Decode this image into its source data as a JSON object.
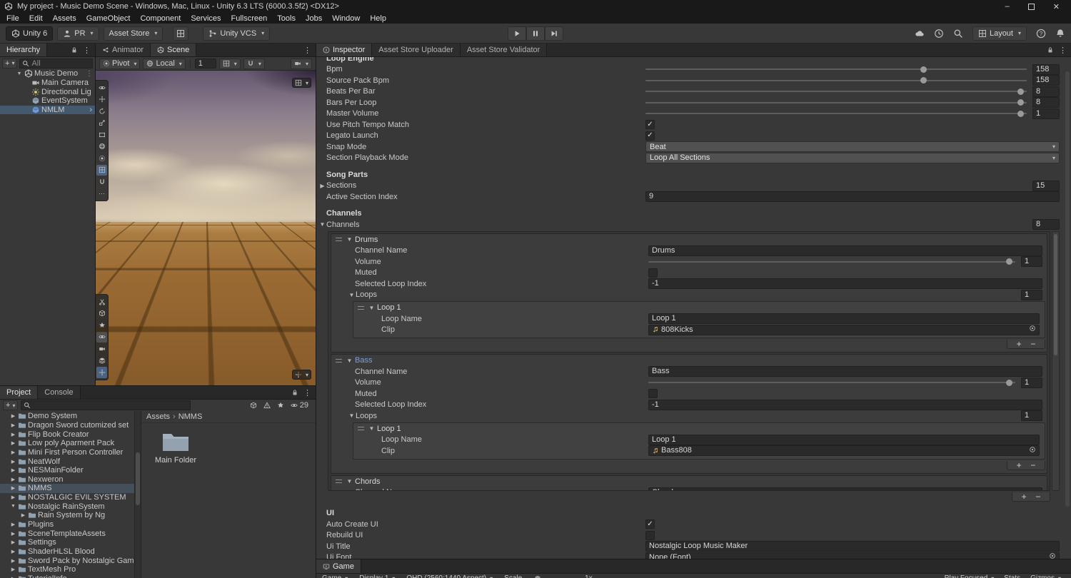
{
  "window": {
    "title": "My project - Music Demo Scene - Windows, Mac, Linux - Unity 6.3 LTS (6000.3.5f2) <DX12>",
    "menus": [
      "File",
      "Edit",
      "Assets",
      "GameObject",
      "Component",
      "Services",
      "Fullscreen",
      "Tools",
      "Jobs",
      "Window",
      "Help"
    ]
  },
  "toolbar": {
    "unity_badge": "Unity 6",
    "account": "PR",
    "asset_store": "Asset Store",
    "vcs": "Unity VCS",
    "layout": "Layout"
  },
  "hierarchy": {
    "tab": "Hierarchy",
    "search_filter": "All",
    "scene_name": "Music Demo",
    "items": [
      {
        "label": "Main Camera",
        "icon": "camera"
      },
      {
        "label": "Directional Lig",
        "icon": "light"
      },
      {
        "label": "EventSystem",
        "icon": "cube"
      },
      {
        "label": "NMLM",
        "icon": "prefab",
        "selected": true,
        "chevron": true
      }
    ]
  },
  "scene_view": {
    "tabs": [
      {
        "label": "Animator",
        "icon": "animator",
        "active": false
      },
      {
        "label": "Scene",
        "icon": "unity",
        "active": true
      }
    ],
    "pivot": "Pivot",
    "local": "Local",
    "grid_value": "1"
  },
  "inspector": {
    "tabs": [
      {
        "label": "Inspector",
        "icon": "info",
        "active": true
      },
      {
        "label": "Asset Store Uploader",
        "active": false
      },
      {
        "label": "Asset Store Validator",
        "active": false
      }
    ],
    "rows_top": [
      {
        "type": "header",
        "label": "Loop Engine",
        "cut": true
      },
      {
        "type": "slider",
        "label": "Bpm",
        "value": "158",
        "frac": 0.73
      },
      {
        "type": "slider",
        "label": "Source Pack Bpm",
        "value": "158",
        "frac": 0.73
      },
      {
        "type": "slider",
        "label": "Beats Per Bar",
        "value": "8",
        "frac": 0.985
      },
      {
        "type": "slider",
        "label": "Bars Per Loop",
        "value": "8",
        "frac": 0.985
      },
      {
        "type": "slider",
        "label": "Master Volume",
        "value": "1",
        "frac": 0.985
      },
      {
        "type": "toggle",
        "label": "Use Pitch Tempo Match",
        "checked": true
      },
      {
        "type": "toggle",
        "label": "Legato Launch",
        "checked": true
      },
      {
        "type": "dropdown",
        "label": "Snap Mode",
        "value": "Beat"
      },
      {
        "type": "dropdown",
        "label": "Section Playback Mode",
        "value": "Loop All Sections"
      },
      {
        "type": "gap"
      },
      {
        "type": "header",
        "label": "Song Parts"
      },
      {
        "type": "foldout",
        "label": "Sections",
        "value": "15",
        "open": false
      },
      {
        "type": "field",
        "label": "Active Section Index",
        "value": "9"
      },
      {
        "type": "gap"
      },
      {
        "type": "header",
        "label": "Channels"
      },
      {
        "type": "foldout",
        "label": "Channels",
        "value": "8",
        "open": true
      }
    ],
    "channel_field_labels": {
      "channel_name": "Channel Name",
      "volume": "Volume",
      "muted": "Muted",
      "selected_loop_index": "Selected Loop Index",
      "loops": "Loops",
      "loop_name": "Loop Name",
      "clip": "Clip"
    },
    "channels": [
      {
        "title": "Drums",
        "override": false,
        "channel_name": "Drums",
        "volume": "1",
        "volume_frac": 0.985,
        "muted": false,
        "selected_loop_index": "-1",
        "loops_count": "1",
        "loops": [
          {
            "title": "Loop 1",
            "loop_name": "Loop 1",
            "clip": "808Kicks"
          }
        ]
      },
      {
        "title": "Bass",
        "override": true,
        "channel_name": "Bass",
        "volume": "1",
        "volume_frac": 0.985,
        "muted": false,
        "selected_loop_index": "-1",
        "loops_count": "1",
        "loops": [
          {
            "title": "Loop 1",
            "loop_name": "Loop 1",
            "clip": "Bass808"
          }
        ]
      },
      {
        "title": "Chords",
        "override": false,
        "channel_name": "Chords",
        "truncated": true
      }
    ],
    "rows_bottom": [
      {
        "type": "header",
        "label": "UI"
      },
      {
        "type": "toggle",
        "label": "Auto Create UI",
        "checked": true
      },
      {
        "type": "toggle",
        "label": "Rebuild UI",
        "checked": false
      },
      {
        "type": "field",
        "label": "Ui Title",
        "value": "Nostalgic Loop Music Maker"
      },
      {
        "type": "objectfield",
        "label": "Ui Font",
        "value": "None (Font)"
      }
    ]
  },
  "project": {
    "tabs": [
      {
        "label": "Project",
        "active": true
      },
      {
        "label": "Console",
        "active": false
      }
    ],
    "hidden_count": "29",
    "breadcrumb": [
      "Assets",
      "NMMS"
    ],
    "folders": [
      {
        "label": "Demo System"
      },
      {
        "label": "Dragon Sword cutomized set"
      },
      {
        "label": "Flip Book Creator"
      },
      {
        "label": "Low poly Aparment Pack"
      },
      {
        "label": "Mini First Person Controller"
      },
      {
        "label": "NeatWolf"
      },
      {
        "label": "NESMainFolder"
      },
      {
        "label": "Nexweron"
      },
      {
        "label": "NMMS",
        "selected": true
      },
      {
        "label": "NOSTALGIC EVIL SYSTEM"
      },
      {
        "label": "Nostalgic RainSystem",
        "open": true
      },
      {
        "label": "Rain System by Ng",
        "depth": 2
      },
      {
        "label": "Plugins"
      },
      {
        "label": "SceneTemplateAssets"
      },
      {
        "label": "Settings"
      },
      {
        "label": "ShaderHLSL Blood"
      },
      {
        "label": "Sword Pack by Nostalgic Games"
      },
      {
        "label": "TextMesh Pro"
      },
      {
        "label": "TutorialInfo"
      }
    ],
    "assets": [
      {
        "label": "Main Folder",
        "type": "folder"
      }
    ]
  },
  "game_view": {
    "tab": "Game",
    "toolbar": {
      "mode": "Game",
      "display": "Display 1",
      "aspect": "QHD (2560:1440 Aspect)",
      "scale": "Scale",
      "scale_value": "1x",
      "play_focused": "Play Focused",
      "stats": "Stats",
      "gizmos": "Gizmos"
    }
  },
  "colors": {
    "selection": "#44586E",
    "prefab_override_blue": "#7F9FD8",
    "ground": "#9A6A33",
    "active_tool": "#4A6283"
  }
}
